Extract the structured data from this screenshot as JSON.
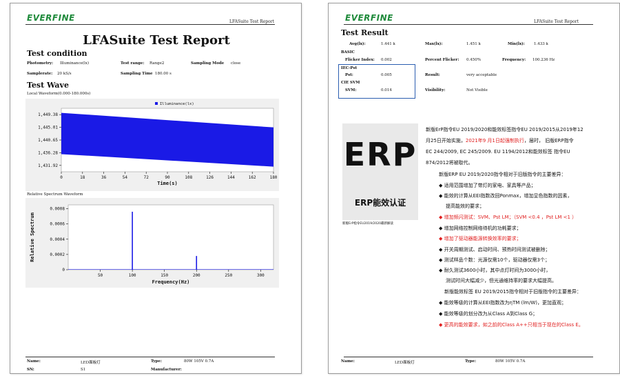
{
  "logo": "EVERFINE",
  "header_right": "LFASuite Test Report",
  "page1": {
    "title": "LFASuite Test Report",
    "test_condition": "Test condition",
    "photometry_label": "Photometry:",
    "photometry_value": "Illuminance(lx)",
    "test_range_label": "Test range:",
    "test_range_value": "Range2",
    "sampling_mode_label": "Sampling Mode",
    "sampling_mode_value": "close",
    "samplerate_label": "Samplerate:",
    "samplerate_value": "20 kS/s",
    "sampling_time_label": "Sampling Time",
    "sampling_time_value": "180.00 s",
    "test_wave": "Test Wave",
    "local_waveform_label": "Local Waveform(0.000-180.000s)",
    "relative_spectrum_label": "Relative Spectrum Waveform",
    "name_label": "Name:",
    "name_value": "LED面板灯",
    "type_label": "Type:",
    "type_value": "80W 105V 0.7A",
    "sn_label": "SN:",
    "sn_value": "S1",
    "manufacturer_label": "Manufacturer:"
  },
  "page2": {
    "test_result": "Test Result",
    "avg_label": "Avg(lx):",
    "avg_value": "1.441 k",
    "max_label": "Max(lx):",
    "max_value": "1.451 k",
    "min_label": "Min(lx):",
    "min_value": "1.433 k",
    "basic_label": "BASIC",
    "flicker_index_label": "Flicker Index:",
    "flicker_index_value": "0.002",
    "percent_flicker_label": "Percent Flicker:",
    "percent_flicker_value": "0.450%",
    "frequency_label": "Frequency:",
    "frequency_value": "100.236 Hz",
    "iec_label": "IEC-Pst",
    "pst_label": "Pst:",
    "pst_value": "0.005",
    "result_label": "Result:",
    "result_value": "very acceptable",
    "cie_label": "CIE SVM",
    "svm_label": "SVM:",
    "svm_value": "0.014",
    "visibility_label": "Visibility:",
    "visibility_value": "Not Visible",
    "erp_big": "ERP",
    "erp_sub": "ERP能效认证",
    "erp_caption": "新版ErP指令EU2019/2020最新解读",
    "text": {
      "p1_l1": "新版ErP指令EU 2019/2020和能效标签指令EU 2019/2015从2019年12",
      "p1_l2a": "月25日开始实施，",
      "p1_l2b": "2021年9 月1日起强制执行",
      "p1_l2c": "，届时， 旧版ERP指令",
      "p1_l3": "EC 244/2009, EC 245/2009. EU 1194/2012和能效标签 指令EU",
      "p1_l4": "874/2012将被取代。",
      "p2": "新版ERP EU 2019/2020指令相对于旧版指令的主要差异：",
      "b1": "◆ 适用范围增加了带灯的家电、家具等产品；",
      "b2a": "◆ 能效的计算从EEI指数改回Ponmax，增加显色指数的因素，",
      "b2b": "提高能效的要求；",
      "b3": "◆ 增加频闪测试：SVM、Pst LM；（SVM <0.4 ，Pst LM <1 ）",
      "b4": "◆ 增加网络控制网络待机的功耗要求；",
      "b5": "◆ 增加了驱动器能源转换效率的要求；",
      "b6": "◆ 开关周期测试、启动时间、预热时间测试被删除；",
      "b7": "◆ 测试样品个数：光源仅需10个，驱动器仅需3个；",
      "b8a": "◆ 耐久测试3600小时，其中点灯时间为3000小时，",
      "b8b": "测试时间大幅减少，但光通维持率的要求大幅提高。",
      "p3": "新版能效标签 EU 2019/2015指令相对于旧版指令的主要差异：",
      "c1": "◆ 能效等级的计算从EEI指数改为ηTM (lm/W)，更加直观；",
      "c2": "◆ 能效等级的划分改为从Class A到Class G；",
      "c3": "◆ 更高的能效要求，如之前的Class A++只相当于现在的Class E。"
    },
    "name_label": "Name:",
    "name_value": "LED面板灯",
    "type_label": "Type:",
    "type_value": "80W 105V 0.7A"
  },
  "chart_data": [
    {
      "type": "line",
      "title": "",
      "legend": "Illuminance(lx)",
      "xlabel": "Time(s)",
      "ylabel": "",
      "x_ticks": [
        0,
        18,
        36,
        54,
        72,
        90,
        108,
        126,
        144,
        162,
        180
      ],
      "y_ticks": [
        "1,431.92",
        "1,436.28",
        "1,440.65",
        "1,445.01",
        "1,449.38"
      ],
      "xlim": [
        0,
        180
      ],
      "ylim": [
        1429.74,
        1451.56
      ],
      "band_upper": [
        {
          "x": 0,
          "y": 1450.0
        },
        {
          "x": 180,
          "y": 1445.0
        }
      ],
      "band_lower": [
        {
          "x": 0,
          "y": 1435.8
        },
        {
          "x": 180,
          "y": 1431.5
        }
      ],
      "color": "#1a1ae6"
    },
    {
      "type": "line",
      "title": "",
      "xlabel": "Frequency(Hz)",
      "ylabel": "Relative Spectrum",
      "x_ticks": [
        50,
        100,
        150,
        200,
        250,
        300
      ],
      "y_ticks": [
        "0",
        "0.0002",
        "0.0004",
        "0.0006",
        "0.0008"
      ],
      "xlim": [
        0,
        320
      ],
      "ylim": [
        0,
        0.00085
      ],
      "peaks": [
        {
          "x": 100,
          "y": 0.00076
        },
        {
          "x": 200,
          "y": 0.00018
        }
      ],
      "color": "#1a1ae6"
    }
  ]
}
